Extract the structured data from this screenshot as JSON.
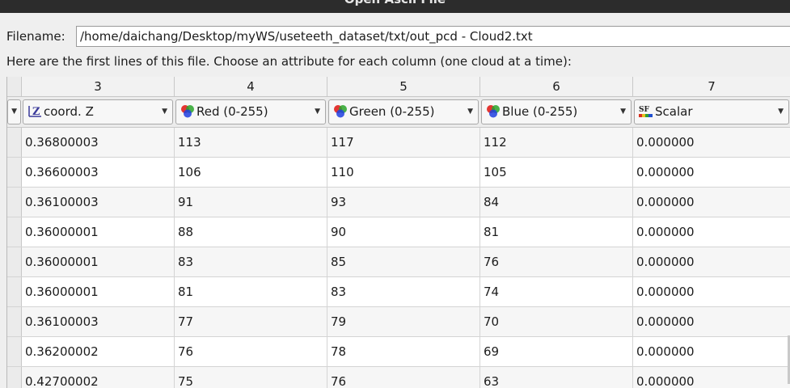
{
  "window": {
    "title": "Open Ascii File"
  },
  "filename": {
    "label": "Filename:",
    "value": "/home/daichang/Desktop/myWS/useteeth_dataset/txt/out_pcd - Cloud2.txt"
  },
  "instructions": "Here are the first lines of this file. Choose an attribute for each column (one cloud at a time):",
  "columns": [
    {
      "number": "3",
      "type": "coord. Z",
      "icon": "coord-z-icon"
    },
    {
      "number": "4",
      "type": "Red (0-255)",
      "icon": "rgb-color-icon"
    },
    {
      "number": "5",
      "type": "Green (0-255)",
      "icon": "rgb-color-icon"
    },
    {
      "number": "6",
      "type": "Blue (0-255)",
      "icon": "rgb-color-icon"
    },
    {
      "number": "7",
      "type": "Scalar",
      "icon": "scalar-field-icon"
    }
  ],
  "rows": [
    [
      "0.36800003",
      "113",
      "117",
      "112",
      "0.000000"
    ],
    [
      "0.36600003",
      "106",
      "110",
      "105",
      "0.000000"
    ],
    [
      "0.36100003",
      "91",
      "93",
      "84",
      "0.000000"
    ],
    [
      "0.36000001",
      "88",
      "90",
      "81",
      "0.000000"
    ],
    [
      "0.36000001",
      "83",
      "85",
      "76",
      "0.000000"
    ],
    [
      "0.36000001",
      "81",
      "83",
      "74",
      "0.000000"
    ],
    [
      "0.36100003",
      "77",
      "79",
      "70",
      "0.000000"
    ],
    [
      "0.36200002",
      "76",
      "78",
      "69",
      "0.000000"
    ],
    [
      "0.42700002",
      "75",
      "76",
      "63",
      "0.000000"
    ]
  ],
  "colors": {
    "titlebar": "#2c2c2c",
    "background": "#efefef",
    "red": "#e0201c",
    "green": "#2aa52a",
    "blue": "#2040e0"
  }
}
